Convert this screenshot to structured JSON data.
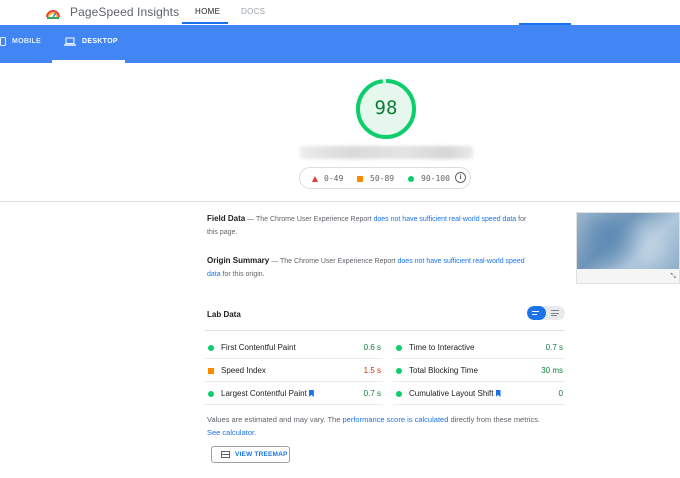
{
  "header": {
    "brand": "PageSpeed Insights",
    "nav": [
      {
        "label": "HOME",
        "active": true
      },
      {
        "label": "DOCS",
        "active": false
      }
    ]
  },
  "device_tabs": [
    {
      "label": "MOBILE",
      "active": false
    },
    {
      "label": "DESKTOP",
      "active": true
    }
  ],
  "score": {
    "value": "98",
    "fraction": 0.98,
    "color": "#0cce6b"
  },
  "legend": {
    "fail": "0-49",
    "average": "50-89",
    "pass": "90-100",
    "info_icon": "info-icon"
  },
  "field_data": {
    "title": "Field Data",
    "text_prefix": " — The Chrome User Experience Report ",
    "link": "does not have sufficient real-world speed data",
    "text_suffix": " for this page."
  },
  "origin_summary": {
    "title": "Origin Summary",
    "text_prefix": " — The Chrome User Experience Report ",
    "link": "does not have sufficient real-world speed data",
    "text_suffix": " for this origin."
  },
  "lab_data": {
    "title": "Lab Data",
    "metrics_left": [
      {
        "label": "First Contentful Paint",
        "value": "0.6 s",
        "status": "pass",
        "flag": false
      },
      {
        "label": "Speed Index",
        "value": "1.5 s",
        "status": "average",
        "flag": false
      },
      {
        "label": "Largest Contentful Paint",
        "value": "0.7 s",
        "status": "pass",
        "flag": true
      }
    ],
    "metrics_right": [
      {
        "label": "Time to Interactive",
        "value": "0.7 s",
        "status": "pass",
        "flag": false
      },
      {
        "label": "Total Blocking Time",
        "value": "30 ms",
        "status": "pass",
        "flag": false
      },
      {
        "label": "Cumulative Layout Shift",
        "value": "0",
        "status": "pass",
        "flag": true
      }
    ]
  },
  "note": {
    "part1": "Values are estimated and may vary. The ",
    "link1": "performance score is calculated",
    "part2": " directly from these metrics. ",
    "link2": "See calculator."
  },
  "treemap_button": {
    "label": "VIEW TREEMAP"
  },
  "colors": {
    "accent": "#4285f4",
    "link": "#1a73e8",
    "pass": "#0cce6b",
    "average": "#fb8c00",
    "fail": "#e53935"
  }
}
